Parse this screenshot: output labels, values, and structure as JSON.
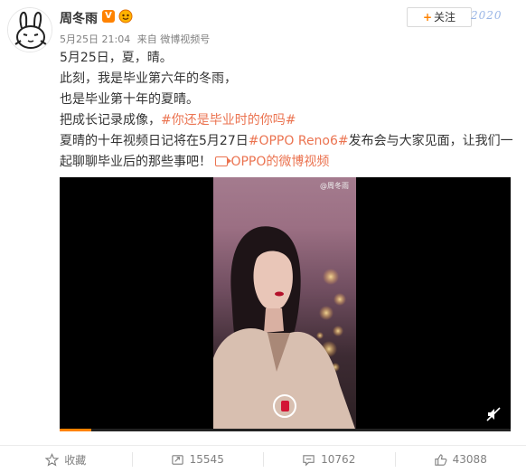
{
  "post": {
    "username": "周冬雨",
    "vip_mark": "V",
    "follow_label": "关注",
    "follow_plus": "+",
    "decor_text": "2020",
    "meta": {
      "time": "5月25日 21:04",
      "source": "来自 微博视频号"
    },
    "content": {
      "line1": "5月25日，夏，晴。",
      "line2": "此刻，我是毕业第六年的冬雨，",
      "line3": "也是毕业第十年的夏晴。",
      "line4_prefix": "把成长记录成像，",
      "line4_tag": "#你还是毕业时的你吗#",
      "line5_prefix": "夏晴的十年视频日记将在5月27日",
      "line5_tag": "#OPPO Reno6#",
      "line5_suffix": "发布会与大家见面，让我们一",
      "line6_prefix": "起聊聊毕业后的那些事吧！ ",
      "line6_link": "OPPO的微博视频"
    },
    "video": {
      "watermark": "@周冬雨",
      "progress": 0.07
    },
    "actions": {
      "favorite_label": "收藏",
      "repost_count": "15545",
      "comment_count": "10762",
      "like_count": "43088"
    },
    "colors": {
      "accent": "#ff8200",
      "tag": "#eb7350",
      "muted": "#808080"
    },
    "icons": [
      "avatar-bunny",
      "vip-v-badge",
      "fan-medal-icon",
      "link-video-icon",
      "play-icon",
      "mute-icon",
      "star-icon",
      "repost-icon",
      "comment-icon",
      "like-icon"
    ]
  }
}
